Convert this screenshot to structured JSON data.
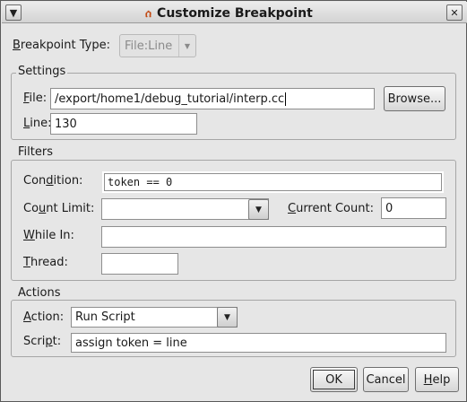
{
  "window": {
    "title": "Customize Breakpoint",
    "app_icon_glyph": "ሰ",
    "menu_icon": "chevron-down-icon",
    "close_icon": "close-icon"
  },
  "breakpoint_type": {
    "label": "Breakpoint Type:",
    "value": "File:Line",
    "enabled": false
  },
  "settings": {
    "title": "Settings",
    "file_label": "File:",
    "file_value": "/export/home1/debug_tutorial/interp.cc",
    "browse_label": "Browse...",
    "line_label": "Line:",
    "line_value": "130"
  },
  "filters": {
    "title": "Filters",
    "condition_label": "Condition:",
    "condition_value": "token == 0",
    "count_limit_label": "Count Limit:",
    "count_limit_value": "",
    "current_count_label": "Current Count:",
    "current_count_value": "0",
    "while_in_label": "While In:",
    "while_in_value": "",
    "thread_label": "Thread:",
    "thread_value": ""
  },
  "actions": {
    "title": "Actions",
    "action_label": "Action:",
    "action_value": "Run Script",
    "script_label": "Script:",
    "script_value": "assign token = line"
  },
  "buttons": {
    "ok": "OK",
    "cancel": "Cancel",
    "help": "Help"
  }
}
